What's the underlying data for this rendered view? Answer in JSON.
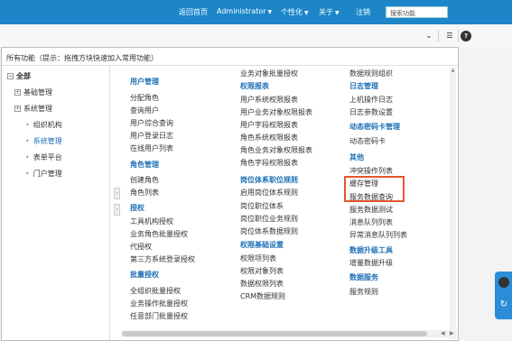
{
  "header": {
    "links": [
      {
        "label": "返回首页",
        "has_caret": false
      },
      {
        "label": "Administrator",
        "has_caret": true
      },
      {
        "label": "个性化",
        "has_caret": true
      },
      {
        "label": "关于",
        "has_caret": true
      },
      {
        "label": "注销",
        "has_caret": false
      }
    ],
    "search_value": "搜索功能"
  },
  "toolbar": {
    "collapse_icon": "double-chevron-down",
    "menu_icon": "list-menu",
    "help_icon": "question-circle"
  },
  "panel": {
    "title": "所有功能（提示：拖拽方块快速加入常用功能）"
  },
  "tree": {
    "root": "全部",
    "nodes": [
      {
        "label": "基础管理",
        "type": "collapsed"
      },
      {
        "label": "系统管理",
        "type": "collapsed"
      },
      {
        "label": "组织机构",
        "type": "leaf"
      },
      {
        "label": "系统管理",
        "type": "leaf-active"
      },
      {
        "label": "表单平台",
        "type": "leaf"
      },
      {
        "label": "门户管理",
        "type": "leaf"
      }
    ]
  },
  "menu": {
    "col1": [
      {
        "label": "用户管理",
        "heading": true
      },
      {
        "label": "分配角色",
        "heading": false
      },
      {
        "label": "查询用户",
        "heading": false
      },
      {
        "label": "用户综合查询",
        "heading": false
      },
      {
        "label": "用户登录日志",
        "heading": false
      },
      {
        "label": "在线用户列表",
        "heading": false
      },
      {
        "label": "角色管理",
        "heading": true
      },
      {
        "label": "创建角色",
        "heading": false
      },
      {
        "label": "角色列表",
        "heading": false
      },
      {
        "label": "授权",
        "heading": true
      },
      {
        "label": "工具机构授权",
        "heading": false
      },
      {
        "label": "业务角色批量授权",
        "heading": false
      },
      {
        "label": "代授权",
        "heading": false
      },
      {
        "label": "第三方系统登录授权",
        "heading": false
      },
      {
        "label": "批量授权",
        "heading": true
      },
      {
        "label": "全组织批量授权",
        "heading": false
      },
      {
        "label": "业务操作批量授权",
        "heading": false
      },
      {
        "label": "任意部门批量授权",
        "heading": false
      }
    ],
    "col2": [
      {
        "label": "业务对象批量授权",
        "heading": false
      },
      {
        "label": "权限报表",
        "heading": true
      },
      {
        "label": "用户系统权限报表",
        "heading": false
      },
      {
        "label": "用户业务对象权限报表",
        "heading": false
      },
      {
        "label": "用户字段权限报表",
        "heading": false
      },
      {
        "label": "角色系统权限报表",
        "heading": false
      },
      {
        "label": "角色业务对象权限报表",
        "heading": false
      },
      {
        "label": "角色字段权限报表",
        "heading": false
      },
      {
        "label": "岗位体系职位规则",
        "heading": true
      },
      {
        "label": "启用岗位体系规则",
        "heading": false
      },
      {
        "label": "岗位职位体系",
        "heading": false
      },
      {
        "label": "岗位职位业务规则",
        "heading": false
      },
      {
        "label": "岗位体系数据规则",
        "heading": false
      },
      {
        "label": "权限基础设置",
        "heading": true
      },
      {
        "label": "权限项列表",
        "heading": false
      },
      {
        "label": "权限对象列表",
        "heading": false
      },
      {
        "label": "数据权限列表",
        "heading": false
      },
      {
        "label": "CRM数据规则",
        "heading": false
      }
    ],
    "col3": [
      {
        "label": "数据规则组织",
        "heading": false
      },
      {
        "label": "日志管理",
        "heading": true
      },
      {
        "label": "上机操作日志",
        "heading": false
      },
      {
        "label": "日志参数设置",
        "heading": false
      },
      {
        "label": "动态密码卡管理",
        "heading": true
      },
      {
        "label": "动态密码卡",
        "heading": false
      },
      {
        "label": "其他",
        "heading": true
      },
      {
        "label": "冲突操作列表",
        "heading": false
      },
      {
        "label": "缓存管理",
        "heading": false
      },
      {
        "label": "服务数据查询",
        "heading": false
      },
      {
        "label": "服务数据测试",
        "heading": false
      },
      {
        "label": "消息队列列表",
        "heading": false
      },
      {
        "label": "异常消息队列列表",
        "heading": false
      },
      {
        "label": "数据升级工具",
        "heading": true
      },
      {
        "label": "增量数据升级",
        "heading": false
      },
      {
        "label": "数据服务",
        "heading": true
      },
      {
        "label": "服务规则",
        "heading": false
      }
    ]
  },
  "colors": {
    "header_bg": "#1c86c9",
    "heading_text": "#1c6fb6",
    "highlight_border": "#e4572e"
  }
}
